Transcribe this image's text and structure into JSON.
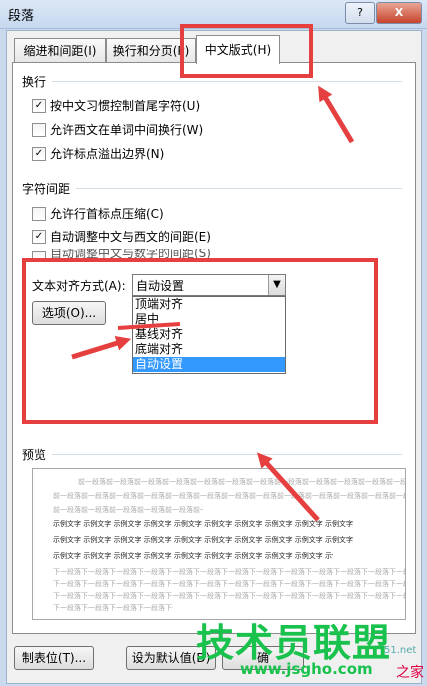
{
  "window": {
    "title": "段落",
    "help_label": "?",
    "close_label": "X"
  },
  "tabs": [
    {
      "label": "缩进和间距(I)"
    },
    {
      "label": "换行和分页(P)"
    },
    {
      "label": "中文版式(H)"
    }
  ],
  "line_break": {
    "label": "换行",
    "options": [
      {
        "label": "按中文习惯控制首尾字符(U)",
        "checked": true
      },
      {
        "label": "允许西文在单词中间换行(W)",
        "checked": false
      },
      {
        "label": "允许标点溢出边界(N)",
        "checked": true
      }
    ]
  },
  "char_spacing": {
    "label": "字符间距",
    "options": [
      {
        "label": "允许行首标点压缩(C)",
        "checked": false
      },
      {
        "label": "自动调整中文与西文的间距(E)",
        "checked": true
      },
      {
        "label": "自动调整中文与数字的间距(S)",
        "checked": true
      }
    ]
  },
  "text_align": {
    "label": "文本对齐方式(A):",
    "selected": "自动设置",
    "options": [
      "顶端对齐",
      "居中",
      "基线对齐",
      "底端对齐",
      "自动设置"
    ]
  },
  "options_button": "选项(O)...",
  "preview": {
    "label": "预览",
    "prev_text": "前一段落前一段落前一段落前一段落前一段落前一段落前一段落前一段落前一段落前一段落前一段落前一段落前一段落前一段落前一段落",
    "sample_text": "示例文字 示例文字 示例文字 示例文字 示例文字 示例文字 示例文字 示例文字 示例文字 示例文字",
    "next_text": "下一段落下一段落下一段落下一段落下一段落下一段落下一段落下一段落下一段落下一段落下一段落下一段落下一段落下一段落下一段落"
  },
  "footer": {
    "tabs_button": "制表位(T)...",
    "default_button": "设为默认值(D)",
    "ok_button": "确"
  },
  "watermark": {
    "text": "技术员联盟",
    "url": "www.jsgho.com",
    "url_suffix": "51.net",
    "side_text": "之家"
  },
  "colors": {
    "annotation": "#e53f3f",
    "selection": "#3399ff",
    "watermark": "#19c24d"
  }
}
